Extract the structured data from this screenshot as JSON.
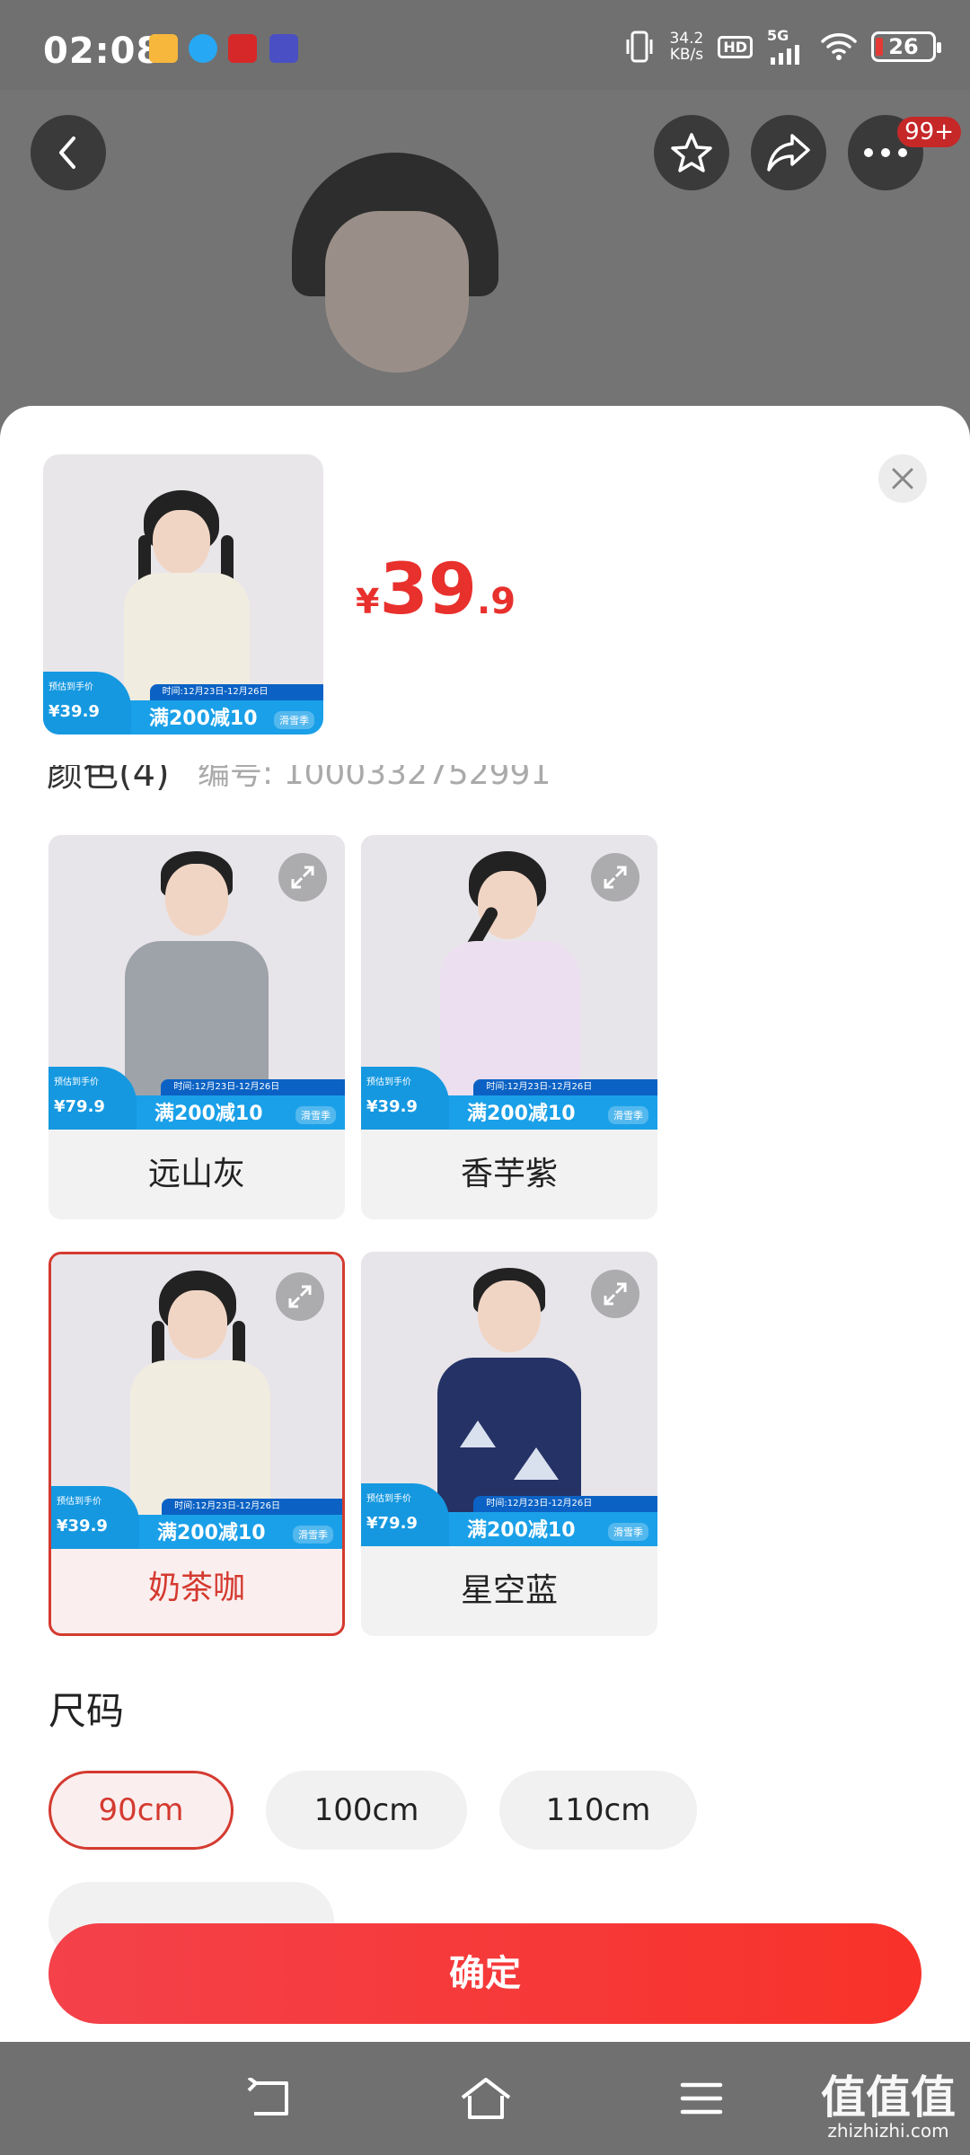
{
  "status_bar": {
    "time": "02:08",
    "net_speed_value": "34.2",
    "net_speed_unit": "KB/s",
    "hd": "HD",
    "signal": "5G",
    "battery": "26"
  },
  "header": {
    "notification_badge": "99+"
  },
  "sheet": {
    "price_symbol": "¥",
    "price_int": "39",
    "price_dec": ".9",
    "section_color_title_partial": "颜色(4)",
    "sku_partial": "编号: 1000332752991",
    "colors": [
      {
        "label": "远山灰",
        "promo_price": "¥79.9"
      },
      {
        "label": "香芋紫",
        "promo_price": "¥39.9"
      },
      {
        "label": "奶茶咖",
        "promo_price": "¥39.9",
        "selected": true
      },
      {
        "label": "星空蓝",
        "promo_price": "¥79.9"
      }
    ],
    "promo": {
      "tag": "预估到手价",
      "deal": "满200减10",
      "time": "时间:12月23日-12月26日",
      "logo": "滑雪季",
      "main_price": "¥39.9"
    },
    "size_title": "尺码",
    "sizes": [
      {
        "label": "90cm",
        "selected": true
      },
      {
        "label": "100cm"
      },
      {
        "label": "110cm"
      }
    ],
    "confirm_label": "确定"
  },
  "watermark": {
    "main": "值值值",
    "sub": "zhizhizhi.com"
  },
  "colors": {
    "accent": "#e8302c",
    "promo_blue": "#1aa0e8"
  }
}
